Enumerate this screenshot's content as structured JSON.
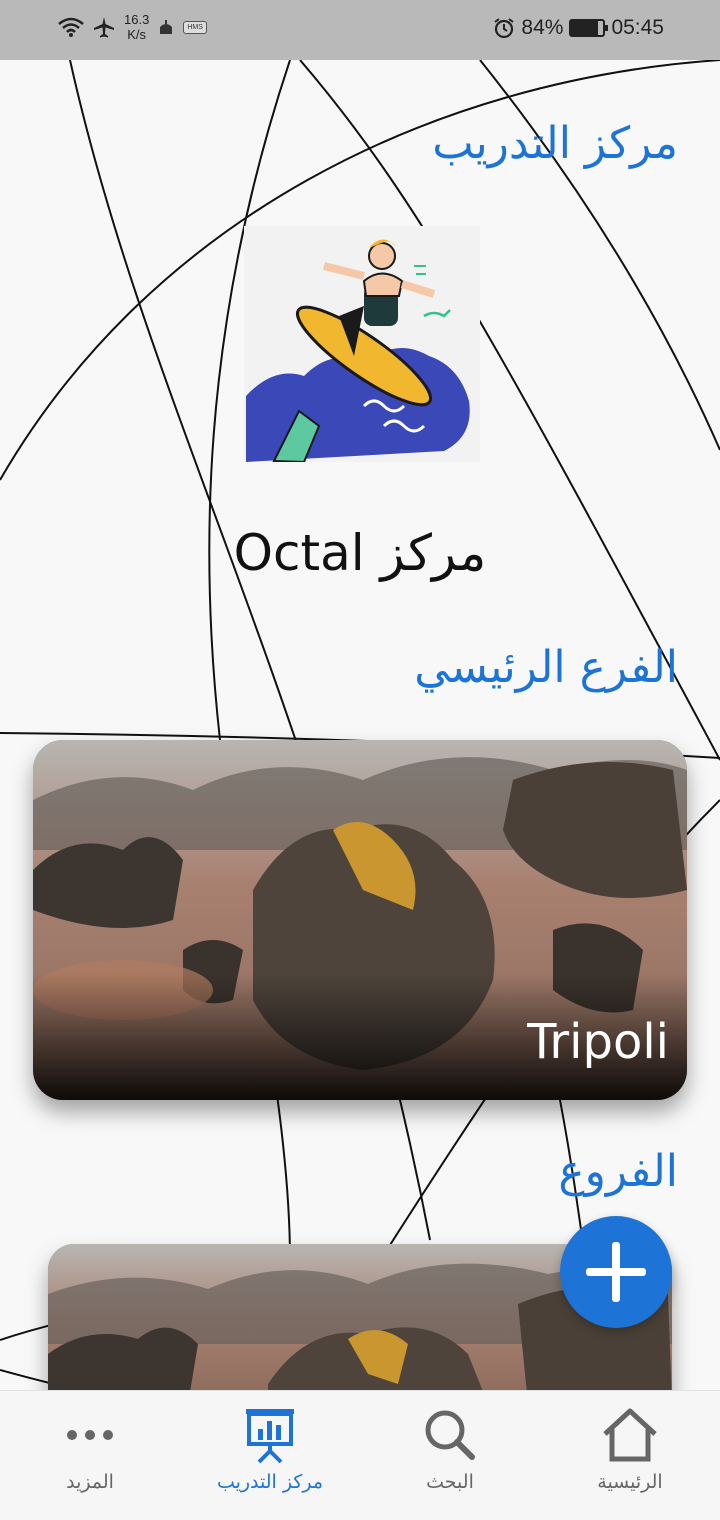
{
  "status_bar": {
    "net_speed_value": "16.3",
    "net_speed_unit": "K/s",
    "badge_text": "HMS",
    "battery_percent": "84%",
    "battery_level": 0.84,
    "time": "05:45"
  },
  "page": {
    "title": "مركز التدريب",
    "center_name": "مركز Octal",
    "main_branch_heading": "الفرع الرئيسي",
    "main_branch": {
      "name": "Tripoli"
    },
    "branches_heading": "الفروع"
  },
  "bottom_nav": {
    "items": [
      {
        "label": "المزيد",
        "icon": "more-dots-icon",
        "active": false
      },
      {
        "label": "مركز التدريب",
        "icon": "presentation-chart-icon",
        "active": true
      },
      {
        "label": "البحث",
        "icon": "search-icon",
        "active": false
      },
      {
        "label": "الرئيسية",
        "icon": "home-icon",
        "active": false
      }
    ]
  },
  "colors": {
    "accent": "#1e74d6",
    "status_bar": "#b9b9b9",
    "background": "#f8f8f8"
  }
}
